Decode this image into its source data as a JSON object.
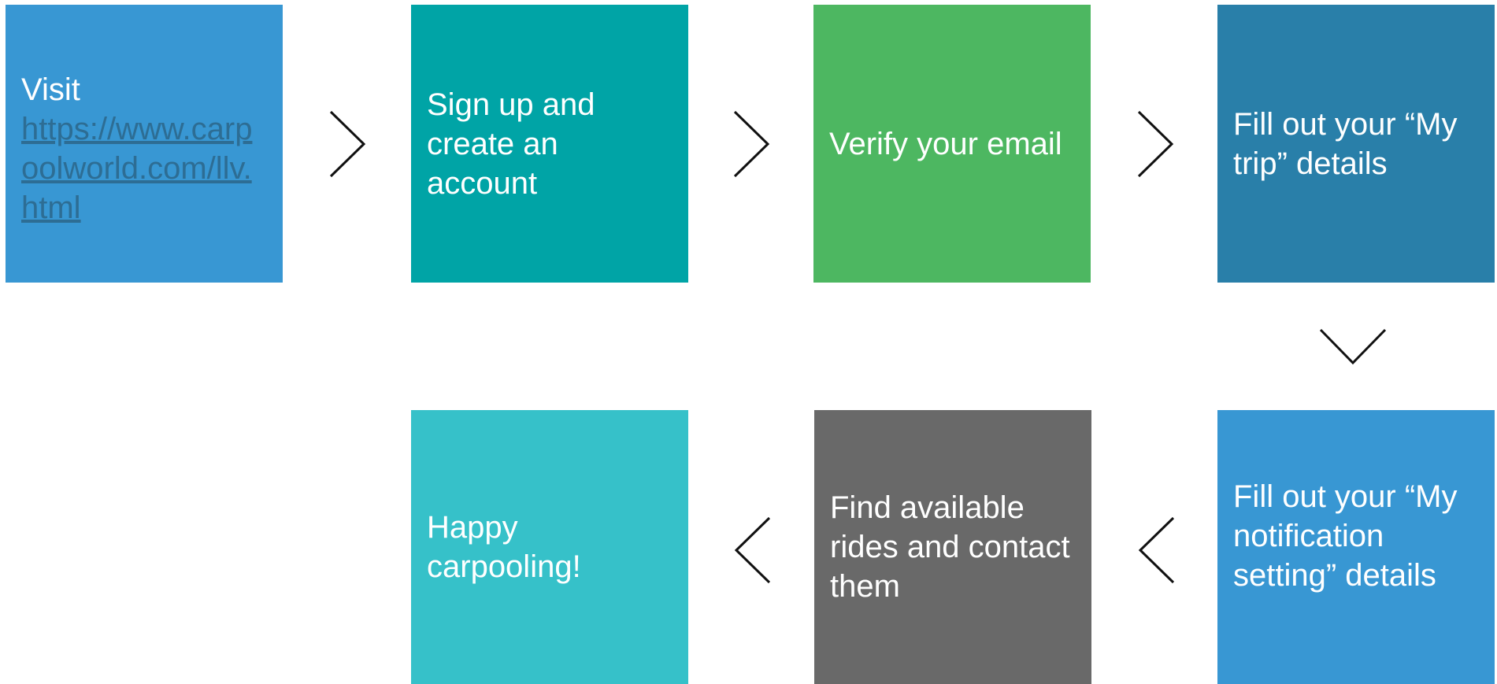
{
  "steps": [
    {
      "text": "Visit",
      "link": "https://www.carpoolworld.com/llv.html",
      "color": "#3897d3"
    },
    {
      "text": "Sign up and create an account",
      "color": "#00a4a6"
    },
    {
      "text": "Verify your email",
      "color": "#4db761"
    },
    {
      "text": "Fill out your “My trip” details",
      "color": "#297fa9"
    },
    {
      "text": "Fill out your “My notification setting” details",
      "color": "#3897d3"
    },
    {
      "text": "Find available rides and contact them",
      "color": "#696969"
    },
    {
      "text": "Happy carpooling!",
      "color": "#36c1c9"
    }
  ],
  "arrow_icons": [
    "chevron-right-icon",
    "chevron-right-icon",
    "chevron-right-icon",
    "chevron-down-icon",
    "chevron-left-icon",
    "chevron-left-icon"
  ]
}
